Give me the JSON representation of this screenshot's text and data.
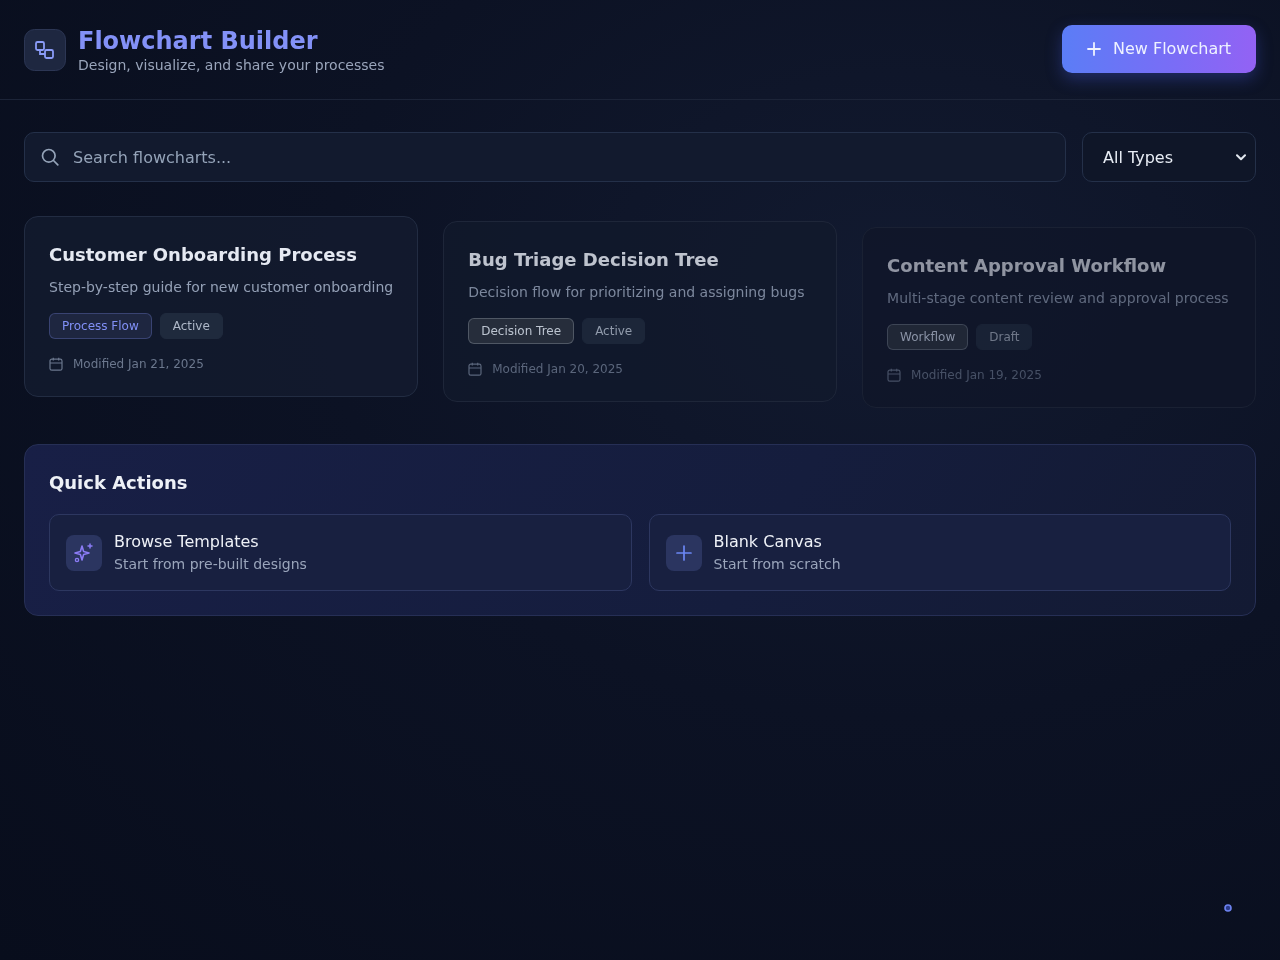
{
  "header": {
    "title": "Flowchart Builder",
    "subtitle": "Design, visualize, and share your processes",
    "new_button": {
      "label": "New Flowchart"
    }
  },
  "search": {
    "placeholder": "Search flowcharts..."
  },
  "type_filter": {
    "value": "All Types"
  },
  "flowcharts": [
    {
      "title": "Customer Onboarding Process",
      "description": "Step-by-step guide for new customer onboarding",
      "type_tag": {
        "label": "Process Flow",
        "color": "#8190f6"
      },
      "status_tag": "Active",
      "modified": "Modified Jan 21, 2025"
    },
    {
      "title": "Bug Triage Decision Tree",
      "description": "Decision flow for prioritizing and assigning bugs",
      "type_tag": {
        "label": "Decision Tree",
        "color": "#bcc4d0"
      },
      "status_tag": "Active",
      "modified": "Modified Jan 20, 2025"
    },
    {
      "title": "Content Approval Workflow",
      "description": "Multi-stage content review and approval process",
      "type_tag": {
        "label": "Workflow",
        "color": "#8a93a6"
      },
      "status_tag": "Draft",
      "modified": "Modified Jan 19, 2025"
    }
  ],
  "quick_actions": {
    "title": "Quick Actions",
    "items": [
      {
        "kind": "templates",
        "title": "Browse Templates",
        "subtitle": "Start from pre-built designs"
      },
      {
        "kind": "blank",
        "title": "Blank Canvas",
        "subtitle": "Start from scratch"
      }
    ]
  }
}
